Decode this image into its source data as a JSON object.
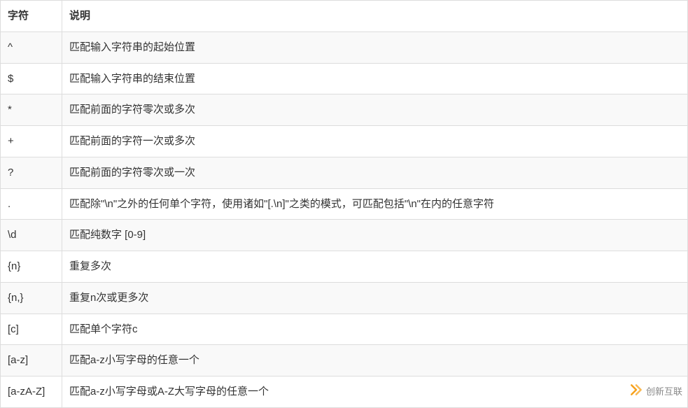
{
  "table": {
    "headers": {
      "char": "字符",
      "desc": "说明"
    },
    "rows": [
      {
        "char": "^",
        "desc": "匹配输入字符串的起始位置"
      },
      {
        "char": "$",
        "desc": "匹配输入字符串的结束位置"
      },
      {
        "char": "*",
        "desc": "匹配前面的字符零次或多次"
      },
      {
        "char": "+",
        "desc": "匹配前面的字符一次或多次"
      },
      {
        "char": "?",
        "desc": "匹配前面的字符零次或一次"
      },
      {
        "char": ".",
        "desc": "匹配除\"\\n\"之外的任何单个字符，使用诸如\"[.\\n]\"之类的模式，可匹配包括\"\\n\"在内的任意字符"
      },
      {
        "char": "\\d",
        "desc": "匹配纯数字 [0-9]"
      },
      {
        "char": "{n}",
        "desc": "重复多次"
      },
      {
        "char": "{n,}",
        "desc": "重复n次或更多次"
      },
      {
        "char": "[c]",
        "desc": "匹配单个字符c"
      },
      {
        "char": "[a-z]",
        "desc": "匹配a-z小写字母的任意一个"
      },
      {
        "char": "[a-zA-Z]",
        "desc": "匹配a-z小写字母或A-Z大写字母的任意一个"
      }
    ]
  },
  "watermark": {
    "text": "创新互联"
  }
}
